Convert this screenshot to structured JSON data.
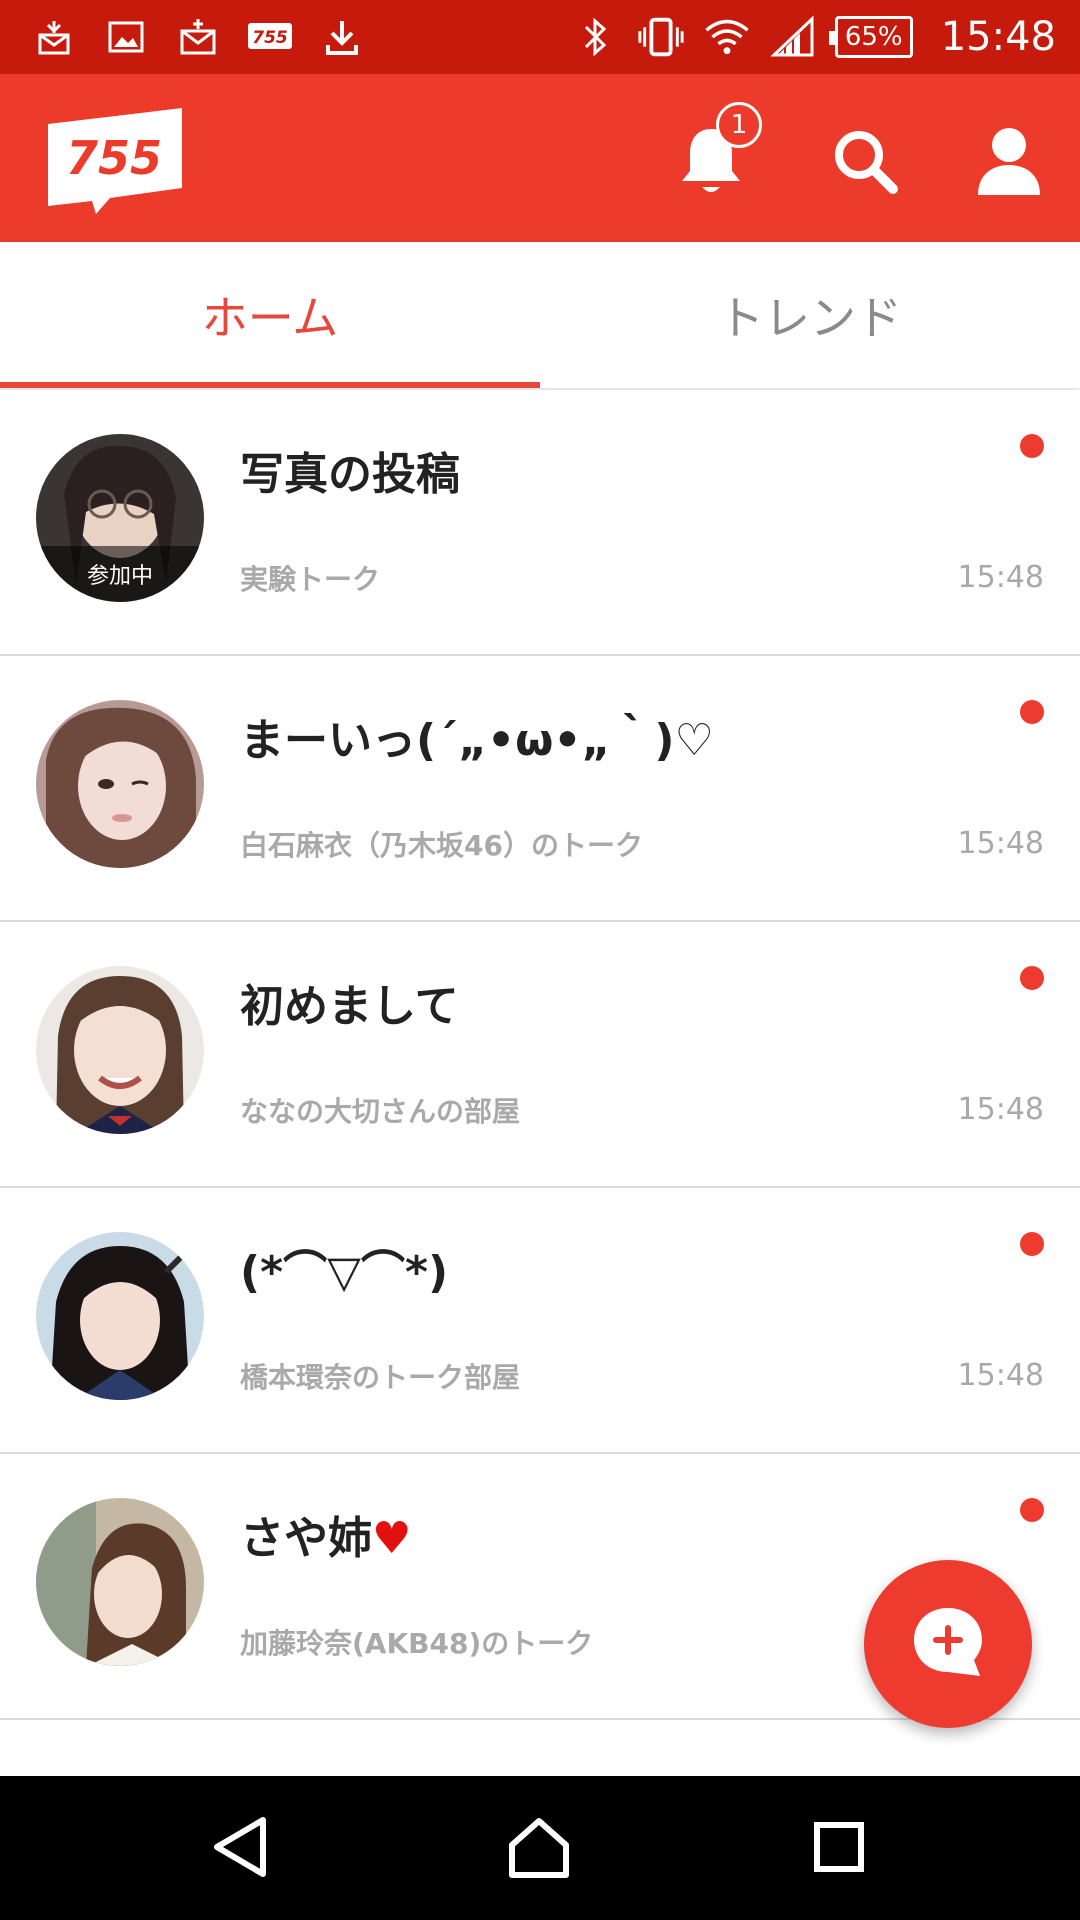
{
  "status_bar": {
    "time": "15:48",
    "battery": "65%",
    "left_icons": [
      "gift-notification-icon",
      "image-icon",
      "mail-icon",
      "755-app-icon",
      "download-icon"
    ],
    "right_icons": [
      "bluetooth-icon",
      "vibrate-icon",
      "wifi-icon",
      "signal-icon"
    ]
  },
  "app_bar": {
    "logo_text": "755",
    "notification_count": "1",
    "icons": [
      "bell-icon",
      "search-icon",
      "profile-icon"
    ]
  },
  "tabs": [
    {
      "label": "ホーム",
      "active": true
    },
    {
      "label": "トレンド",
      "active": false
    }
  ],
  "talks": [
    {
      "title": "写真の投稿",
      "subtitle": "実験トーク",
      "time": "15:48",
      "badge": "参加中",
      "unread": true
    },
    {
      "title": "まーいっ(´„•ω•„｀)♡",
      "subtitle": "白石麻衣（乃木坂46）のトーク",
      "time": "15:48",
      "unread": true
    },
    {
      "title": "初めまして",
      "subtitle": "ななの大切さんの部屋",
      "time": "15:48",
      "unread": true
    },
    {
      "title": "(*⌒▽⌒*)",
      "subtitle": "橋本環奈のトーク部屋",
      "time": "15:48",
      "unread": true
    },
    {
      "title": "さや姉",
      "title_emoji": "♥",
      "subtitle": "加藤玲奈(AKB48)のトーク",
      "time": "",
      "unread": true
    }
  ],
  "colors": {
    "status_bar": "#c51a0c",
    "app_bar": "#ec3a2b",
    "accent": "#e8483b",
    "unread_dot": "#ee3b30"
  },
  "fab": {
    "icon": "new-talk-icon"
  },
  "nav_bar": {
    "icons": [
      "back-icon",
      "home-icon",
      "recent-apps-icon"
    ]
  }
}
